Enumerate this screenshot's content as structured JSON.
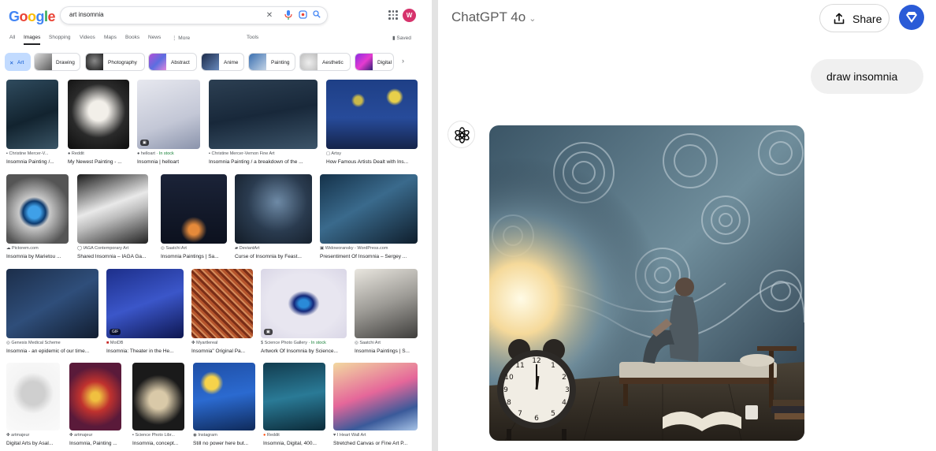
{
  "google": {
    "logo": [
      "G",
      "o",
      "o",
      "g",
      "l",
      "e"
    ],
    "query": "art insomnia",
    "avatar_letter": "W",
    "tabs": [
      "All",
      "Images",
      "Shopping",
      "Videos",
      "Maps",
      "Books",
      "News",
      "⋮ More"
    ],
    "tools": "Tools",
    "saved": "Saved",
    "chips": [
      "Art",
      "Drawing",
      "Photography",
      "Abstract",
      "Anime",
      "Painting",
      "Aesthetic",
      "Digital"
    ],
    "results": [
      {
        "source": "Christine Mercer-V...",
        "title": "Insomnia Painting /..."
      },
      {
        "source": "Reddit",
        "title": "My Newest Painting - ..."
      },
      {
        "source": "helloart",
        "stock": "· In stock",
        "title": "Insomnia | helloart"
      },
      {
        "source": "Christine Mercer-Vernon Fine Art",
        "title": "Insomnia Painting / a breakdown of the ..."
      },
      {
        "source": "Artsy",
        "title": "How Famous Artists Dealt with Ins..."
      },
      {
        "source": "Pictorem.com",
        "title": "Insomnia by Marietou ..."
      },
      {
        "source": "IAGA Contemporary Art",
        "title": "Shared Insomnia – IAGA Ga..."
      },
      {
        "source": "Saatchi Art",
        "title": "Insomnia Paintings | Sa..."
      },
      {
        "source": "DeviantArt",
        "title": "Curse of Insomnia by Feast..."
      },
      {
        "source": "Widoworansky - WordPress.com",
        "title": "Presentiment Of Insomnia – Sergey ..."
      },
      {
        "source": "Genesis Medical Scheme",
        "title": "Insomnia - an epidemic of our time..."
      },
      {
        "source": "MoiDB",
        "title": "Insomnia: Theater in the He..."
      },
      {
        "source": "Myartlereal",
        "title": "Insomnia\" Original Pa..."
      },
      {
        "source": "Science Photo Gallery",
        "stock": "· In stock",
        "title": "Artwork Of Insomnia by Science..."
      },
      {
        "source": "Saatchi Art",
        "title": "Insomnia Paintings | S..."
      },
      {
        "source": "artmajeur",
        "title": "Digital Arts by Asal..."
      },
      {
        "source": "artmajeur",
        "title": "Insomnia, Painting ..."
      },
      {
        "source": "Science Photo Libr...",
        "title": "Insomnia, concept..."
      },
      {
        "source": "Instagram",
        "title": "Still no power here but..."
      },
      {
        "source": "Reddit",
        "title": "Insomnia, Digital, 400..."
      },
      {
        "source": "I Heart Wall Art",
        "title": "Stretched Canvas or Fine Art P..."
      }
    ],
    "badges": {
      "gif": "GIF"
    }
  },
  "chat": {
    "model": "ChatGPT 4o",
    "share": "Share",
    "user_message": "draw insomnia"
  },
  "colors": {
    "google_blue": "#1a73e8",
    "chip_selected": "#c2dbff",
    "gem": "#2a5bd7"
  }
}
